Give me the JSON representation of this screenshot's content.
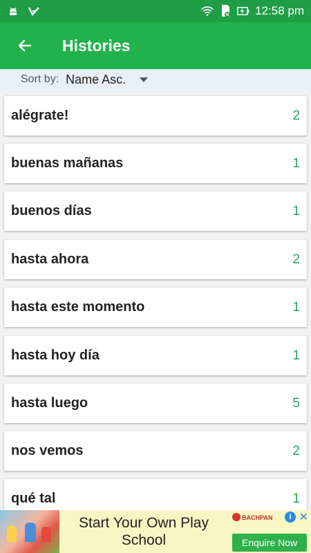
{
  "status_bar": {
    "time": "12:58 pm",
    "icons": [
      "android-icon",
      "check-icon",
      "wifi-icon",
      "sd-card-icon",
      "battery-charging-icon"
    ]
  },
  "app_bar": {
    "title": "Histories",
    "back_icon": "arrow-left-icon"
  },
  "sort": {
    "label": "Sort by:",
    "selected": "Name Asc."
  },
  "histories": [
    {
      "phrase": "alégrate!",
      "count": "2"
    },
    {
      "phrase": "buenas mañanas",
      "count": "1"
    },
    {
      "phrase": "buenos días",
      "count": "1"
    },
    {
      "phrase": "hasta ahora",
      "count": "2"
    },
    {
      "phrase": "hasta este momento",
      "count": "1"
    },
    {
      "phrase": "hasta hoy día",
      "count": "1"
    },
    {
      "phrase": "hasta luego",
      "count": "5"
    },
    {
      "phrase": "nos vemos",
      "count": "2"
    },
    {
      "phrase": "qué tal",
      "count": "1"
    }
  ],
  "ad": {
    "headline_line1": "Start Your Own Play",
    "headline_line2": "School",
    "brand": "BACHPAN",
    "cta": "Enquire Now",
    "info_icon": "i",
    "close_icon": "✕"
  },
  "colors": {
    "status_bar": "#1f9e45",
    "app_bar": "#22b24c",
    "count_text": "#25a65a",
    "sort_bar": "#e7f0f7",
    "ad_bg": "#f9f6c5",
    "cta_bg": "#2fb04c"
  }
}
